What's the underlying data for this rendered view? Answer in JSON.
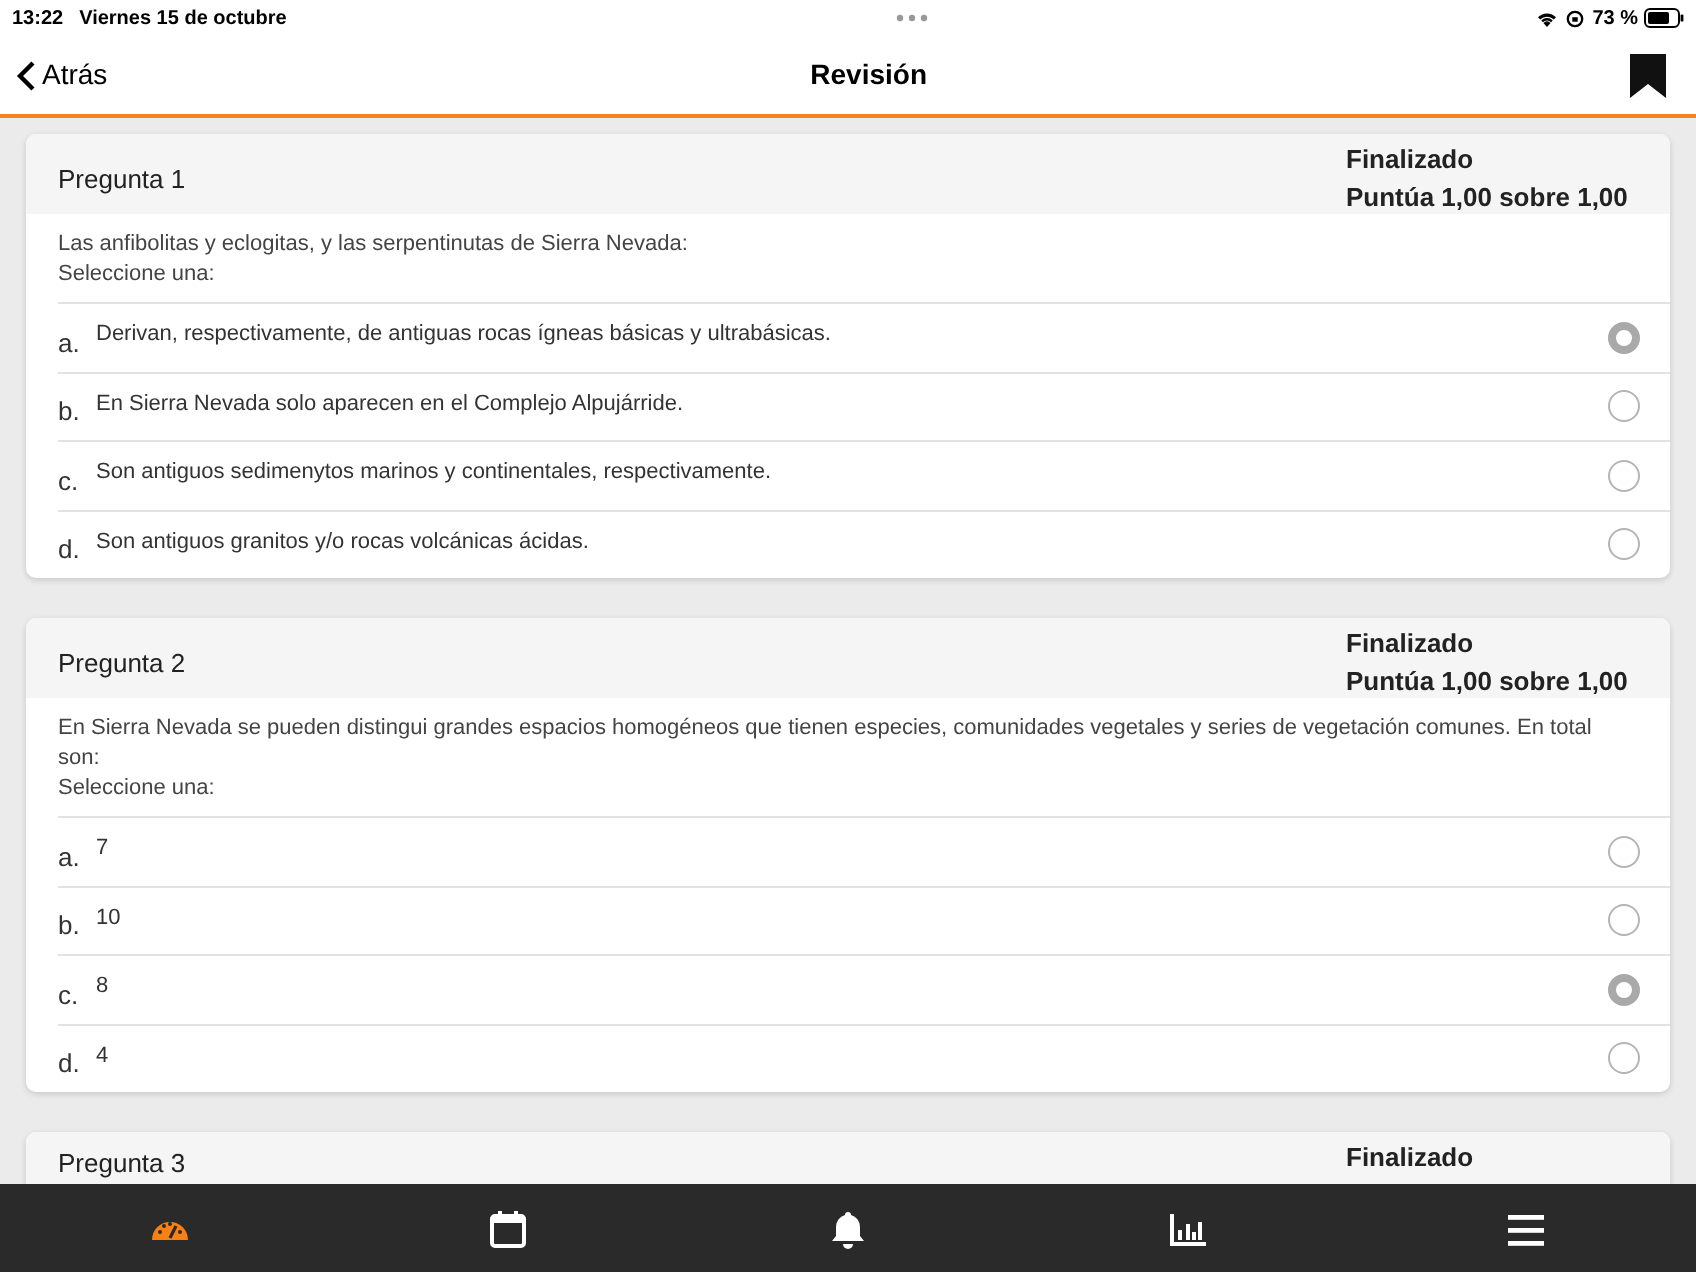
{
  "status_bar": {
    "time": "13:22",
    "date": "Viernes 15 de octubre",
    "battery": "73 %"
  },
  "nav": {
    "back": "Atrás",
    "title": "Revisión"
  },
  "questions": [
    {
      "title": "Pregunta 1",
      "state": "Finalizado",
      "grade": "Puntúa 1,00 sobre 1,00",
      "text": "Las anfibolitas y eclogitas, y las serpentinutas de Sierra Nevada:",
      "prompt": "Seleccione una:",
      "options": [
        {
          "letter": "a.",
          "text": "Derivan, respectivamente, de antiguas rocas ígneas básicas y ultrabásicas.",
          "selected": true
        },
        {
          "letter": "b.",
          "text": "En Sierra Nevada solo aparecen en el Complejo Alpujárride.",
          "selected": false
        },
        {
          "letter": "c.",
          "text": "Son antiguos sedimenytos marinos y continentales, respectivamente.",
          "selected": false
        },
        {
          "letter": "d.",
          "text": "Son antiguos granitos y/o rocas volcánicas ácidas.",
          "selected": false
        }
      ]
    },
    {
      "title": "Pregunta 2",
      "state": "Finalizado",
      "grade": "Puntúa 1,00 sobre 1,00",
      "text": "En Sierra Nevada se pueden distingui grandes espacios homogéneos que tienen especies, comunidades vegetales y series de vegetación comunes. En total son:",
      "prompt": "Seleccione una:",
      "options": [
        {
          "letter": "a.",
          "text": "7",
          "selected": false
        },
        {
          "letter": "b.",
          "text": "10",
          "selected": false
        },
        {
          "letter": "c.",
          "text": "8",
          "selected": true
        },
        {
          "letter": "d.",
          "text": "4",
          "selected": false
        }
      ]
    },
    {
      "title": "Pregunta 3",
      "state": "Finalizado"
    }
  ],
  "tab_bar": [
    {
      "kind": "gauge",
      "selected": true
    },
    {
      "kind": "calendar",
      "selected": false
    },
    {
      "kind": "bell",
      "selected": false
    },
    {
      "kind": "chart",
      "selected": false
    },
    {
      "kind": "menu",
      "selected": false
    }
  ]
}
